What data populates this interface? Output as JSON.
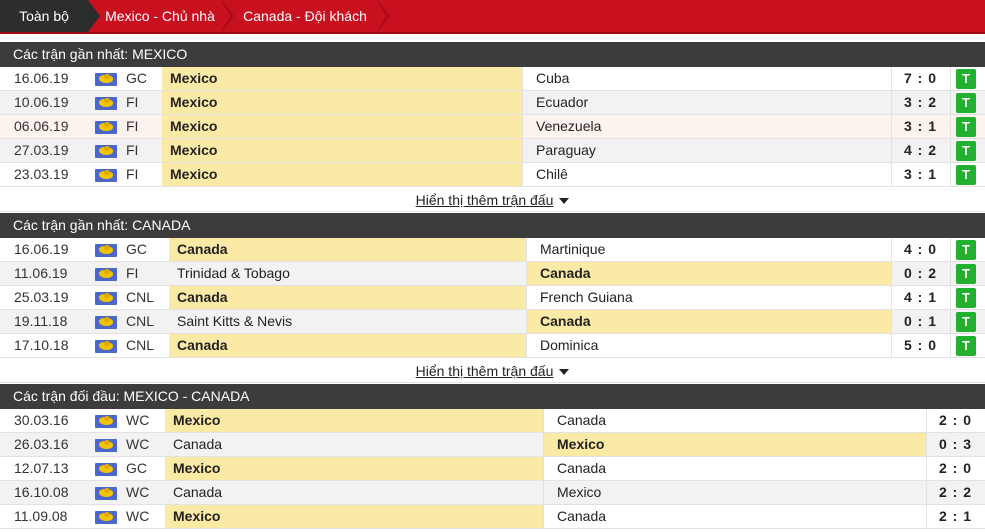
{
  "tabs": [
    "Toàn bộ",
    "Mexico - Chủ nhà",
    "Canada - Đội khách"
  ],
  "colors": {
    "tab_bg": "#c8101e",
    "tab_active": "#2d2d2d",
    "section_bg": "#3c3c3c",
    "winner_bg": "#fbe9a6",
    "result_win": "#23b02f"
  },
  "mexico": {
    "title": "Các trận gần nhất: MEXICO",
    "more": "Hiển thị thêm trận đấu",
    "matches": [
      {
        "date": "16.06.19",
        "league": "GC",
        "home": "Mexico",
        "away": "Cuba",
        "score": "7 : 0",
        "result": "T"
      },
      {
        "date": "10.06.19",
        "league": "FI",
        "home": "Mexico",
        "away": "Ecuador",
        "score": "3 : 2",
        "result": "T"
      },
      {
        "date": "06.06.19",
        "league": "FI",
        "home": "Mexico",
        "away": "Venezuela",
        "score": "3 : 1",
        "result": "T"
      },
      {
        "date": "27.03.19",
        "league": "FI",
        "home": "Mexico",
        "away": "Paraguay",
        "score": "4 : 2",
        "result": "T"
      },
      {
        "date": "23.03.19",
        "league": "FI",
        "home": "Mexico",
        "away": "Chilê",
        "score": "3 : 1",
        "result": "T"
      }
    ]
  },
  "canada": {
    "title": "Các trận gần nhất: CANADA",
    "more": "Hiển thị thêm trận đấu",
    "matches": [
      {
        "date": "16.06.19",
        "league": "GC",
        "home": "Canada",
        "away": "Martinique",
        "score": "4 : 0",
        "result": "T"
      },
      {
        "date": "11.06.19",
        "league": "FI",
        "home": "Trinidad & Tobago",
        "away": "Canada",
        "score": "0 : 2",
        "result": "T"
      },
      {
        "date": "25.03.19",
        "league": "CNL",
        "home": "Canada",
        "away": "French Guiana",
        "score": "4 : 1",
        "result": "T"
      },
      {
        "date": "19.11.18",
        "league": "CNL",
        "home": "Saint Kitts & Nevis",
        "away": "Canada",
        "score": "0 : 1",
        "result": "T"
      },
      {
        "date": "17.10.18",
        "league": "CNL",
        "home": "Canada",
        "away": "Dominica",
        "score": "5 : 0",
        "result": "T"
      }
    ]
  },
  "h2h": {
    "title": "Các trận đối đầu: MEXICO - CANADA",
    "matches": [
      {
        "date": "30.03.16",
        "league": "WC",
        "home": "Mexico",
        "away": "Canada",
        "score": "2 : 0"
      },
      {
        "date": "26.03.16",
        "league": "WC",
        "home": "Canada",
        "away": "Mexico",
        "score": "0 : 3"
      },
      {
        "date": "12.07.13",
        "league": "GC",
        "home": "Mexico",
        "away": "Canada",
        "score": "2 : 0"
      },
      {
        "date": "16.10.08",
        "league": "WC",
        "home": "Canada",
        "away": "Mexico",
        "score": "2 : 2"
      },
      {
        "date": "11.09.08",
        "league": "WC",
        "home": "Mexico",
        "away": "Canada",
        "score": "2 : 1"
      }
    ]
  }
}
